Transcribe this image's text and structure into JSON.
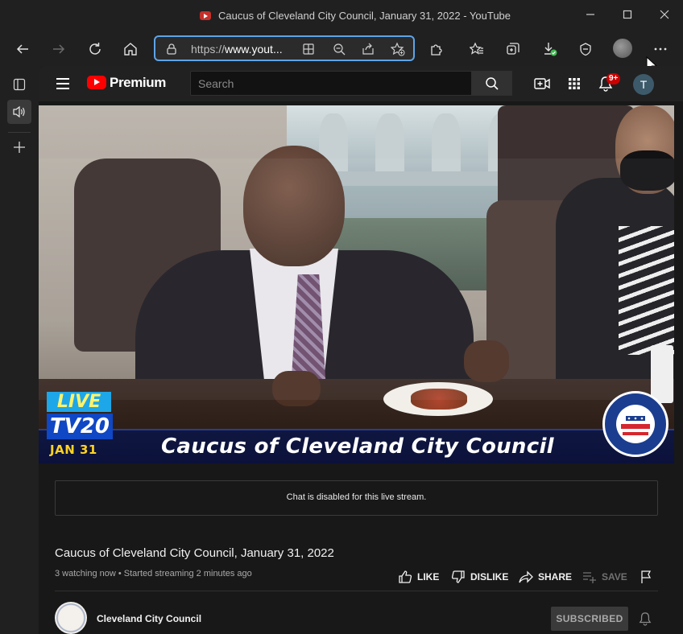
{
  "browser": {
    "window_title": "Caucus of Cleveland City Council, January 31, 2022 - YouTube",
    "url_prefix": "https://",
    "url_host": "www.yout...",
    "window_controls": [
      "minimize-icon",
      "maximize-icon",
      "close-icon"
    ],
    "toolbar_icons": [
      "back-icon",
      "forward-icon",
      "refresh-icon",
      "home-icon",
      "lock-icon",
      "split-screen-icon",
      "zoom-out-icon",
      "share-icon",
      "add-favorite-icon",
      "extensions-icon",
      "favorites-icon",
      "collections-icon",
      "downloads-icon",
      "browser-essentials-icon",
      "profile-avatar",
      "more-icon"
    ],
    "sidebar_icons": [
      "vertical-tabs-icon",
      "speaker-icon",
      "new-tab-icon"
    ]
  },
  "youtube": {
    "logo_text": "Premium",
    "search_placeholder": "Search",
    "notification_count": "9+",
    "user_initial": "T",
    "header_icons": [
      "menu-icon",
      "search-icon",
      "create-video-icon",
      "apps-icon",
      "notifications-icon"
    ]
  },
  "video": {
    "overlay_title": "Caucus of Cleveland City Council",
    "bug_live": "LIVE",
    "bug_channel": "TV20",
    "bug_date": "JAN 31",
    "seal_text": "CITY OF CLEVELAND OHIO"
  },
  "chat": {
    "message": "Chat is disabled for this live stream."
  },
  "info": {
    "title": "Caucus of Cleveland City Council, January 31, 2022",
    "meta": "3 watching now • Started streaming 2 minutes ago",
    "actions": {
      "like": "LIKE",
      "dislike": "DISLIKE",
      "share": "SHARE",
      "save": "SAVE"
    },
    "channel_name": "Cleveland City Council",
    "subscribe_label": "SUBSCRIBED"
  }
}
